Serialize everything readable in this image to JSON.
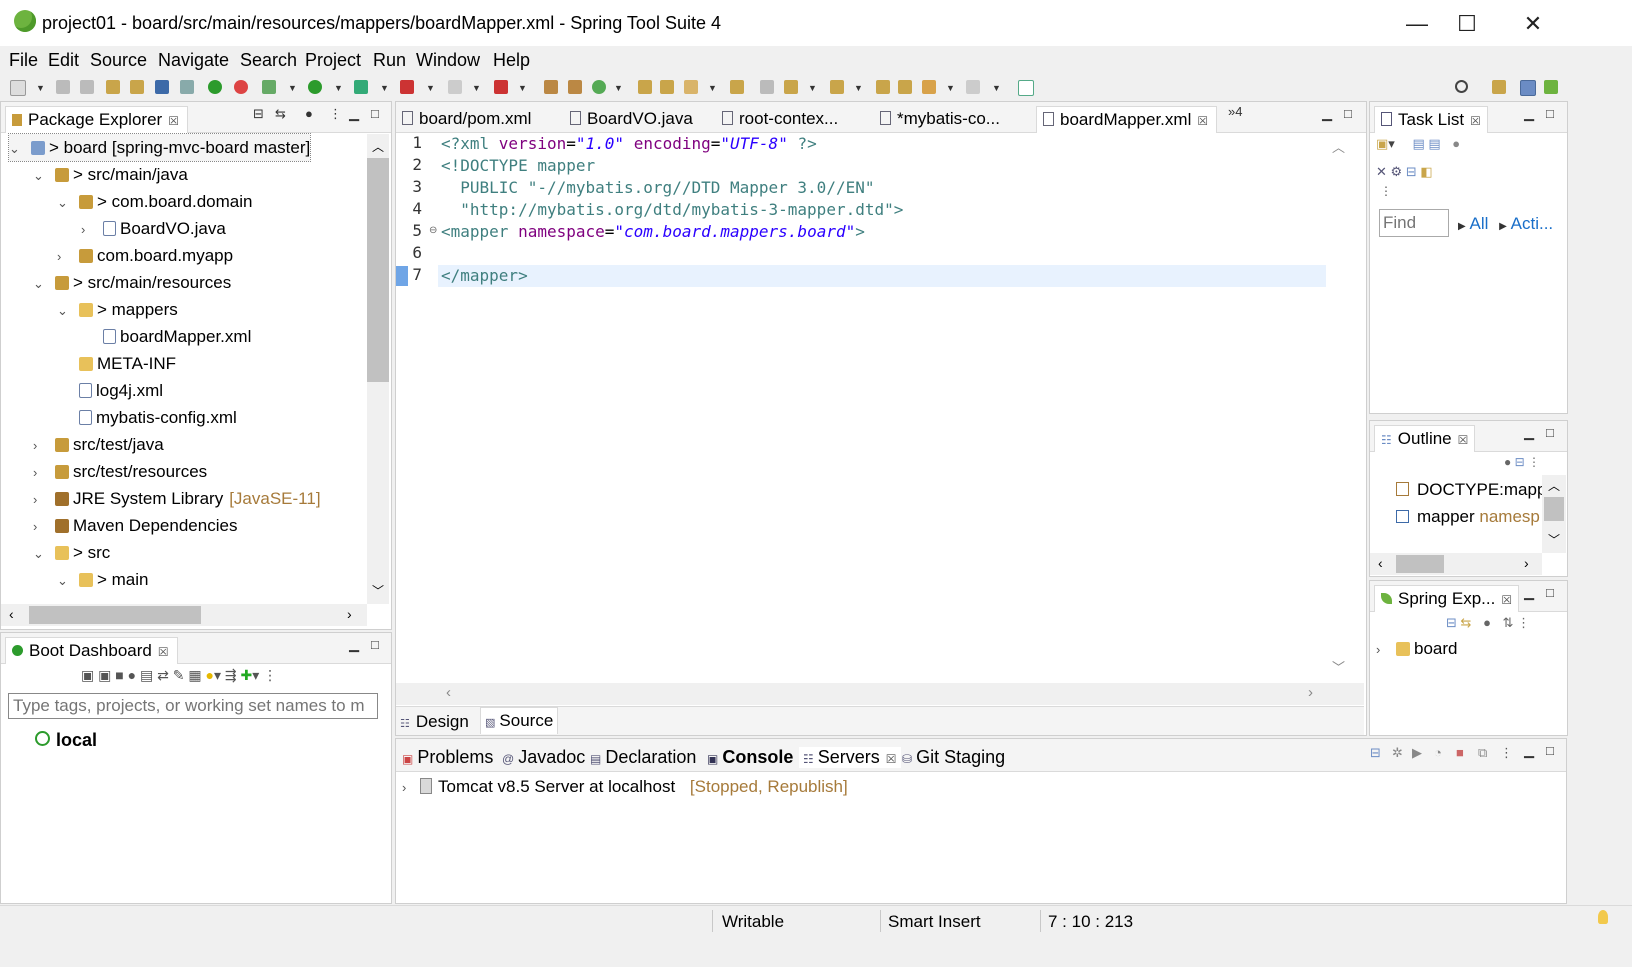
{
  "window": {
    "title": "project01 - board/src/main/resources/mappers/boardMapper.xml - Spring Tool Suite 4",
    "minimize": "—",
    "maximize": "☐",
    "close": "✕"
  },
  "menu": [
    "File",
    "Edit",
    "Source",
    "Navigate",
    "Search",
    "Project",
    "Run",
    "Window",
    "Help"
  ],
  "package_explorer": {
    "tab_label": "Package Explorer",
    "tree": [
      {
        "text": "> board [spring-mvc-board master]",
        "twist": "⌄",
        "icon": "project-icon"
      },
      {
        "text": "> src/main/java",
        "twist": "⌄",
        "icon": "source-folder-icon"
      },
      {
        "text": "> com.board.domain",
        "twist": "⌄",
        "icon": "package-icon"
      },
      {
        "text": "BoardVO.java",
        "twist": "›",
        "icon": "java-file-icon"
      },
      {
        "text": "com.board.myapp",
        "twist": "›",
        "icon": "package-icon"
      },
      {
        "text": "> src/main/resources",
        "twist": "⌄",
        "icon": "source-folder-icon"
      },
      {
        "text": "> mappers",
        "twist": "⌄",
        "icon": "folder-icon"
      },
      {
        "text": "boardMapper.xml",
        "twist": "",
        "icon": "xml-file-icon"
      },
      {
        "text": "META-INF",
        "twist": "",
        "icon": "folder-icon"
      },
      {
        "text": "log4j.xml",
        "twist": "",
        "icon": "xml-file-icon"
      },
      {
        "text": "mybatis-config.xml",
        "twist": "",
        "icon": "xml-file-icon"
      },
      {
        "text": "src/test/java",
        "twist": "›",
        "icon": "source-folder-icon"
      },
      {
        "text": "src/test/resources",
        "twist": "›",
        "icon": "source-folder-icon"
      },
      {
        "text": "JRE System Library",
        "suffix": "[JavaSE-11]",
        "twist": "›",
        "icon": "library-icon"
      },
      {
        "text": "Maven Dependencies",
        "twist": "›",
        "icon": "library-icon"
      },
      {
        "text": "> src",
        "twist": "⌄",
        "icon": "folder-icon"
      },
      {
        "text": "> main",
        "twist": "⌄",
        "icon": "folder-icon"
      }
    ]
  },
  "boot_dashboard": {
    "tab_label": "Boot Dashboard",
    "filter_placeholder": "Type tags, projects, or working set names to m",
    "local_label": "local"
  },
  "editor": {
    "tabs": [
      "board/pom.xml",
      "BoardVO.java",
      "root-contex...",
      "*mybatis-co...",
      "boardMapper.xml"
    ],
    "overflow": "»4",
    "line_numbers": [
      "1",
      "2",
      "3",
      "4",
      "5",
      "6",
      "7"
    ],
    "fold_marker": "⊖",
    "lines": [
      {
        "pi": "<?xml ",
        "attr1": "version",
        "eq1": "=",
        "val1": "\"1.0\"",
        "sp": " ",
        "attr2": "encoding",
        "eq2": "=",
        "val2": "\"UTF-8\"",
        "end": " ?>"
      },
      {
        "text": "<!DOCTYPE mapper"
      },
      {
        "text": "  PUBLIC \"-//mybatis.org//DTD Mapper 3.0//EN\""
      },
      {
        "text": "  \"http://mybatis.org/dtd/mybatis-3-mapper.dtd\">"
      },
      {
        "tag": "<mapper ",
        "attr": "namespace",
        "eq": "=",
        "val": "\"com.board.mappers.board\"",
        "end": ">"
      },
      {
        "text": ""
      },
      {
        "text": "</mapper>"
      }
    ],
    "bottom_tabs": [
      "Design",
      "Source"
    ]
  },
  "task_list": {
    "tab_label": "Task List",
    "find_placeholder": "Find",
    "all_label": "All",
    "acti_label": "Acti..."
  },
  "outline": {
    "tab_label": "Outline",
    "items": [
      {
        "text": "DOCTYPE:mappe"
      },
      {
        "text": "mapper",
        "extra": "namesp"
      }
    ]
  },
  "spring_explorer": {
    "tab_label": "Spring Exp...",
    "items": [
      "board"
    ]
  },
  "bottom_panel": {
    "tabs": [
      "Problems",
      "Javadoc",
      "Declaration",
      "Console",
      "Servers",
      "Git Staging"
    ],
    "server_name": "Tomcat v8.5 Server at localhost",
    "server_state": "[Stopped, Republish]"
  },
  "status": {
    "writable": "Writable",
    "insert_mode": "Smart Insert",
    "position": "7 : 10 : 213"
  },
  "colors": {
    "xml_tag": "#3f7f7f",
    "xml_attr": "#7f007f",
    "xml_value": "#2a00ff",
    "highlight_line": "#e8f2fe"
  }
}
